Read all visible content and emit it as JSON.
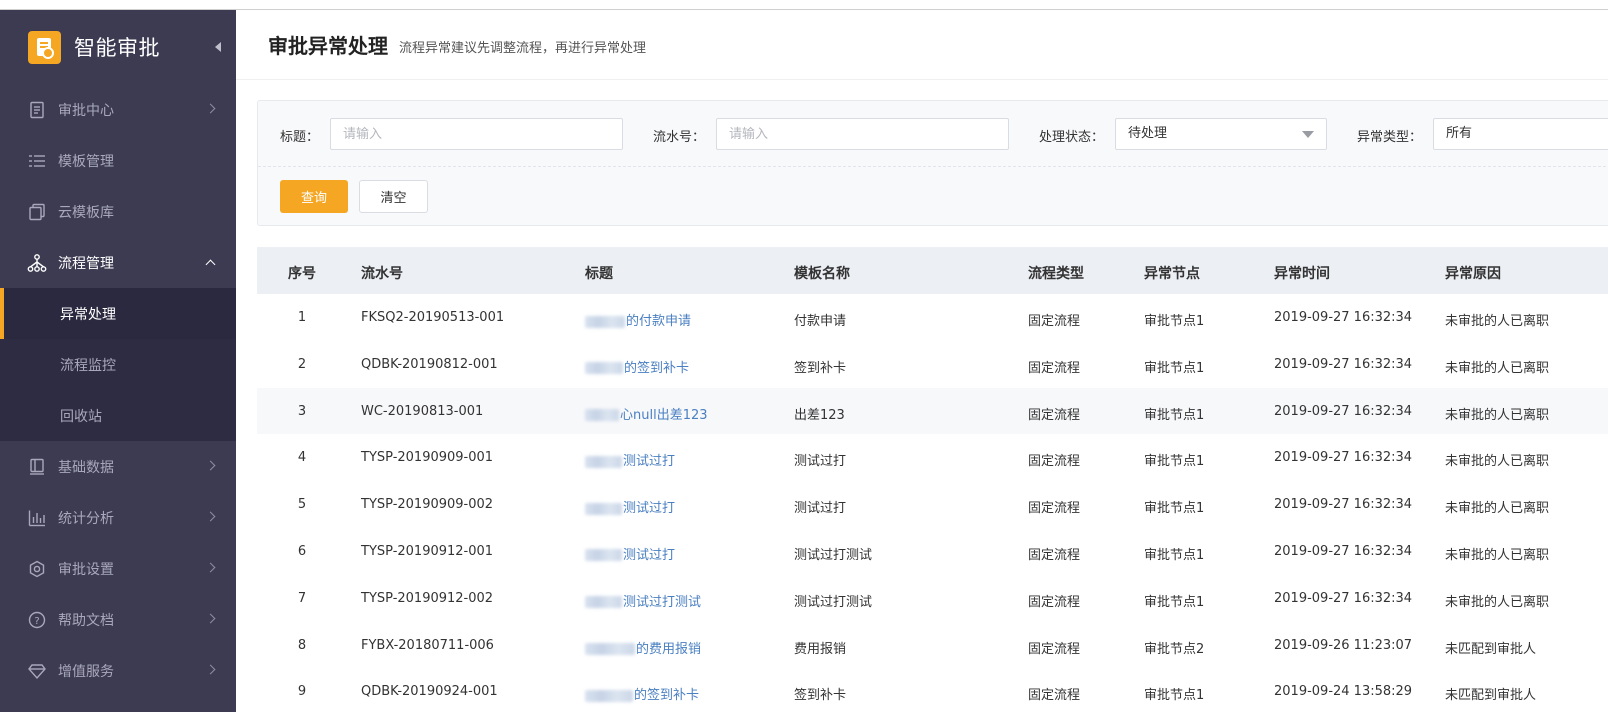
{
  "app": {
    "title": "智能审批",
    "logo_icon": "approval-doc-icon",
    "accent_color": "#f5a623"
  },
  "sidebar": {
    "items": [
      {
        "label": "审批中心",
        "icon": "approval-center-icon"
      },
      {
        "label": "模板管理",
        "icon": "template-list-icon"
      },
      {
        "label": "云模板库",
        "icon": "cloud-template-icon"
      },
      {
        "label": "流程管理",
        "icon": "flow-icon",
        "expanded": true,
        "children": [
          {
            "label": "异常处理",
            "active": true
          },
          {
            "label": "流程监控"
          },
          {
            "label": "回收站"
          }
        ]
      },
      {
        "label": "基础数据",
        "icon": "basic-data-icon"
      },
      {
        "label": "统计分析",
        "icon": "statistics-icon"
      },
      {
        "label": "审批设置",
        "icon": "settings-gear-icon"
      },
      {
        "label": "帮助文档",
        "icon": "help-icon"
      },
      {
        "label": "增值服务",
        "icon": "value-added-icon"
      }
    ]
  },
  "header": {
    "title": "审批异常处理",
    "subtitle": "流程异常建议先调整流程，再进行异常处理"
  },
  "filters": {
    "title_label": "标题：",
    "title_placeholder": "请输入",
    "serial_label": "流水号：",
    "serial_placeholder": "请输入",
    "status_label": "处理状态：",
    "status_value": "待处理",
    "type_label": "异常类型：",
    "type_value": "所有",
    "query_button": "查询",
    "clear_button": "清空"
  },
  "table": {
    "columns": [
      "序号",
      "流水号",
      "标题",
      "模板名称",
      "流程类型",
      "异常节点",
      "异常时间",
      "异常原因"
    ],
    "rows": [
      {
        "no": "1",
        "serial": "FKSQ2-20190513-001",
        "title": "的付款申请",
        "template": "付款申请",
        "flow_type": "固定流程",
        "node": "审批节点1",
        "time": "2019-09-27 16:32:34",
        "reason": "未审批的人已离职"
      },
      {
        "no": "2",
        "serial": "QDBK-20190812-001",
        "title": "的签到补卡",
        "template": "签到补卡",
        "flow_type": "固定流程",
        "node": "审批节点1",
        "time": "2019-09-27 16:32:34",
        "reason": "未审批的人已离职"
      },
      {
        "no": "3",
        "serial": "WC-20190813-001",
        "title": "心null出差123",
        "template": "出差123",
        "flow_type": "固定流程",
        "node": "审批节点1",
        "time": "2019-09-27 16:32:34",
        "reason": "未审批的人已离职"
      },
      {
        "no": "4",
        "serial": "TYSP-20190909-001",
        "title": "测试过打",
        "template": "测试过打",
        "flow_type": "固定流程",
        "node": "审批节点1",
        "time": "2019-09-27 16:32:34",
        "reason": "未审批的人已离职"
      },
      {
        "no": "5",
        "serial": "TYSP-20190909-002",
        "title": "测试过打",
        "template": "测试过打",
        "flow_type": "固定流程",
        "node": "审批节点1",
        "time": "2019-09-27 16:32:34",
        "reason": "未审批的人已离职"
      },
      {
        "no": "6",
        "serial": "TYSP-20190912-001",
        "title": "测试过打",
        "template": "测试过打测试",
        "flow_type": "固定流程",
        "node": "审批节点1",
        "time": "2019-09-27 16:32:34",
        "reason": "未审批的人已离职"
      },
      {
        "no": "7",
        "serial": "TYSP-20190912-002",
        "title": "测试过打测试",
        "template": "测试过打测试",
        "flow_type": "固定流程",
        "node": "审批节点1",
        "time": "2019-09-27 16:32:34",
        "reason": "未审批的人已离职"
      },
      {
        "no": "8",
        "serial": "FYBX-20180711-006",
        "title": "的费用报销",
        "template": "费用报销",
        "flow_type": "固定流程",
        "node": "审批节点2",
        "time": "2019-09-26 11:23:07",
        "reason": "未匹配到审批人"
      },
      {
        "no": "9",
        "serial": "QDBK-20190924-001",
        "title": "的签到补卡",
        "template": "签到补卡",
        "flow_type": "固定流程",
        "node": "审批节点1",
        "time": "2019-09-24 13:58:29",
        "reason": "未匹配到审批人"
      }
    ]
  }
}
